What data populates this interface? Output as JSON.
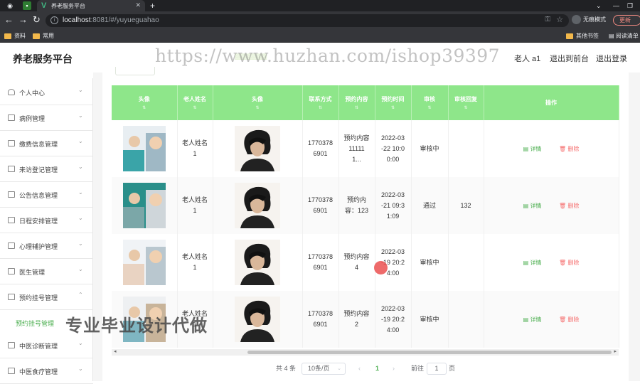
{
  "browser": {
    "tab_title": "养老服务平台",
    "url_host": "localhost",
    "url_rest": ":8081/#/yuyueguahao",
    "incognito_label": "无痕模式",
    "update_label": "更新",
    "bookmarks": [
      "资料",
      "常用"
    ],
    "bookmarks_right": [
      "其他书签",
      "阅读清单"
    ]
  },
  "header": {
    "brand": "养老服务平台",
    "user": "老人 a1",
    "back_front": "退出到前台",
    "logout": "退出登录"
  },
  "watermark": "https://www.huzhan.com/ishop39397",
  "overlay_text": "专业毕业设计代做",
  "sidebar": {
    "items": [
      {
        "label": "个人中心"
      },
      {
        "label": "病例管理"
      },
      {
        "label": "缴费信息管理"
      },
      {
        "label": "来访登记管理"
      },
      {
        "label": "公告信息管理"
      },
      {
        "label": "日程安排管理"
      },
      {
        "label": "心理辅护管理"
      },
      {
        "label": "医生管理"
      },
      {
        "label": "预约挂号管理"
      }
    ],
    "active_sub": "预约挂号管理",
    "items_after": [
      {
        "label": "中医诊断管理"
      },
      {
        "label": "中医食疗管理"
      }
    ]
  },
  "table": {
    "headers": [
      "头像",
      "老人姓名",
      "头像",
      "联系方式",
      "预约内容",
      "预约时间",
      "审核",
      "审核回复",
      "操作"
    ],
    "rows": [
      {
        "name": "老人姓名\n1",
        "phone": "1770378\n6901",
        "content": "预约内容\n11111\n1...",
        "time": "2022-03\n-22 10:0\n0:00",
        "status": "审核中",
        "reply": ""
      },
      {
        "name": "老人姓名\n1",
        "phone": "1770378\n6901",
        "content": "预约内\n容：123",
        "time": "2022-03\n-21 09:3\n1:09",
        "status": "通过",
        "reply": "132"
      },
      {
        "name": "老人姓名\n1",
        "phone": "1770378\n6901",
        "content": "预约内容\n4",
        "time": "2022-03\n-19 20:2\n4:00",
        "status": "审核中",
        "reply": ""
      },
      {
        "name": "老人姓名\n1",
        "phone": "1770378\n6901",
        "content": "预约内容\n2",
        "time": "2022-03\n-19 20:2\n4:00",
        "status": "审核中",
        "reply": ""
      }
    ],
    "detail_label": "详情",
    "delete_label": "删除"
  },
  "pagination": {
    "total": "共 4 条",
    "page_size": "10条/页",
    "current": "1",
    "goto_label": "前往",
    "goto_value": "1",
    "page_unit": "页"
  }
}
